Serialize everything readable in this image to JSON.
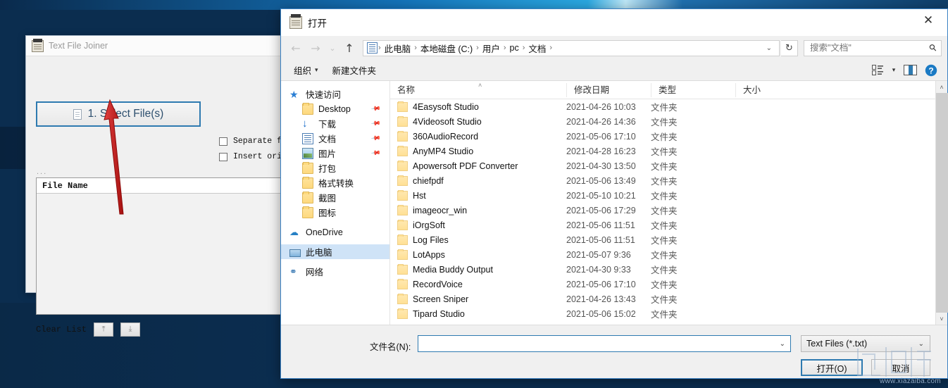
{
  "background_app": {
    "title": "Text File Joiner",
    "title_icon": "text-file-joiner-icon",
    "select_button": {
      "label": "1. Select File(s)",
      "icon": "document-icon"
    },
    "checkboxes": [
      {
        "label": "Separate file con",
        "checked": false
      },
      {
        "label": "Insert original f",
        "checked": false
      }
    ],
    "dots": "...",
    "list_header": "File Name",
    "clear_list_label": "Clear List",
    "mini_buttons": [
      {
        "icon": "move-to-top-icon",
        "glyph": "⤒"
      },
      {
        "icon": "move-to-bottom-icon",
        "glyph": "⤓"
      }
    ],
    "annotation": {
      "type": "red-arrow",
      "color": "#c0211f"
    }
  },
  "dialog": {
    "title": "打开",
    "title_icon": "open-dialog-icon",
    "close_label": "✕",
    "nav": {
      "back": {
        "icon": "back-arrow-icon",
        "glyph": "←",
        "enabled": false
      },
      "forward": {
        "icon": "forward-arrow-icon",
        "glyph": "→",
        "enabled": false
      },
      "recent": {
        "icon": "chevron-down-icon",
        "glyph": "⌄",
        "enabled": false
      },
      "up": {
        "icon": "up-arrow-icon",
        "glyph": "↑",
        "enabled": true
      }
    },
    "breadcrumb": {
      "icon": "documents-folder-icon",
      "segments": [
        "此电脑",
        "本地磁盘 (C:)",
        "用户",
        "pc",
        "文档"
      ],
      "separator": "›",
      "caret": "⌄"
    },
    "refresh": {
      "icon": "refresh-icon",
      "glyph": "↻"
    },
    "search": {
      "placeholder": "搜索\"文档\"",
      "value": "",
      "icon": "search-icon"
    },
    "toolbar": {
      "organize": {
        "label": "组织",
        "caret": "▾"
      },
      "new_folder": {
        "label": "新建文件夹"
      },
      "view": {
        "icon": "view-options-icon",
        "caret": "▾"
      },
      "preview_pane": {
        "icon": "preview-pane-icon"
      },
      "help": {
        "icon": "help-icon",
        "glyph": "?"
      }
    },
    "navpane": [
      {
        "label": "快速访问",
        "icon": "quick-access-icon",
        "kind": "star",
        "indent": false,
        "pin": false,
        "selected": false
      },
      {
        "label": "Desktop",
        "icon": "folder-icon",
        "kind": "folder",
        "indent": true,
        "pin": true,
        "selected": false
      },
      {
        "label": "下载",
        "icon": "downloads-icon",
        "kind": "down",
        "indent": true,
        "pin": true,
        "selected": false
      },
      {
        "label": "文档",
        "icon": "documents-icon",
        "kind": "doc",
        "indent": true,
        "pin": true,
        "selected": false
      },
      {
        "label": "图片",
        "icon": "pictures-icon",
        "kind": "pic",
        "indent": true,
        "pin": true,
        "selected": false
      },
      {
        "label": "打包",
        "icon": "folder-icon",
        "kind": "folder",
        "indent": true,
        "pin": false,
        "selected": false
      },
      {
        "label": "格式转换",
        "icon": "folder-icon",
        "kind": "folder",
        "indent": true,
        "pin": false,
        "selected": false
      },
      {
        "label": "截图",
        "icon": "folder-icon",
        "kind": "folder",
        "indent": true,
        "pin": false,
        "selected": false
      },
      {
        "label": "图标",
        "icon": "folder-icon",
        "kind": "folder",
        "indent": true,
        "pin": false,
        "selected": false
      },
      {
        "label": "OneDrive",
        "icon": "onedrive-icon",
        "kind": "cloud",
        "indent": false,
        "pin": false,
        "selected": false,
        "gap_before": true
      },
      {
        "label": "此电脑",
        "icon": "this-pc-icon",
        "kind": "pc",
        "indent": false,
        "pin": false,
        "selected": true,
        "gap_before": true
      },
      {
        "label": "网络",
        "icon": "network-icon",
        "kind": "net",
        "indent": false,
        "pin": false,
        "selected": false,
        "gap_before": true
      }
    ],
    "columns": [
      {
        "key": "name",
        "label": "名称"
      },
      {
        "key": "date",
        "label": "修改日期"
      },
      {
        "key": "type",
        "label": "类型"
      },
      {
        "key": "size",
        "label": "大小"
      }
    ],
    "sort_indicator": "˄",
    "files": [
      {
        "name": "4Easysoft Studio",
        "date": "2021-04-26 10:03",
        "type": "文件夹",
        "size": ""
      },
      {
        "name": "4Videosoft Studio",
        "date": "2021-04-26 14:36",
        "type": "文件夹",
        "size": ""
      },
      {
        "name": "360AudioRecord",
        "date": "2021-05-06 17:10",
        "type": "文件夹",
        "size": ""
      },
      {
        "name": "AnyMP4 Studio",
        "date": "2021-04-28 16:23",
        "type": "文件夹",
        "size": ""
      },
      {
        "name": "Apowersoft PDF Converter",
        "date": "2021-04-30 13:50",
        "type": "文件夹",
        "size": ""
      },
      {
        "name": "chiefpdf",
        "date": "2021-05-06 13:49",
        "type": "文件夹",
        "size": ""
      },
      {
        "name": "Hst",
        "date": "2021-05-10 10:21",
        "type": "文件夹",
        "size": ""
      },
      {
        "name": "imageocr_win",
        "date": "2021-05-06 17:29",
        "type": "文件夹",
        "size": ""
      },
      {
        "name": "iOrgSoft",
        "date": "2021-05-06 11:51",
        "type": "文件夹",
        "size": ""
      },
      {
        "name": "Log Files",
        "date": "2021-05-06 11:51",
        "type": "文件夹",
        "size": ""
      },
      {
        "name": "LotApps",
        "date": "2021-05-07 9:36",
        "type": "文件夹",
        "size": ""
      },
      {
        "name": "Media Buddy Output",
        "date": "2021-04-30 9:33",
        "type": "文件夹",
        "size": ""
      },
      {
        "name": "RecordVoice",
        "date": "2021-05-06 17:10",
        "type": "文件夹",
        "size": ""
      },
      {
        "name": "Screen Sniper",
        "date": "2021-04-26 13:43",
        "type": "文件夹",
        "size": ""
      },
      {
        "name": "Tipard Studio",
        "date": "2021-05-06 15:02",
        "type": "文件夹",
        "size": ""
      }
    ],
    "scrollbar": {
      "up": "˄",
      "down": "˅"
    },
    "bottom": {
      "filename_label": "文件名(N):",
      "filename_value": "",
      "filename_caret": "⌄",
      "filter_value": "Text Files (*.txt)",
      "filter_caret": "⌄",
      "open_label": "打开(O)",
      "cancel_label": "取消"
    }
  },
  "watermark": {
    "url": "www.xiazaiba.com"
  },
  "colors": {
    "accent": "#2e7ab0",
    "selection": "#cfe3f7",
    "desktop": "#0b2d4f",
    "arrow": "#c0211f"
  }
}
